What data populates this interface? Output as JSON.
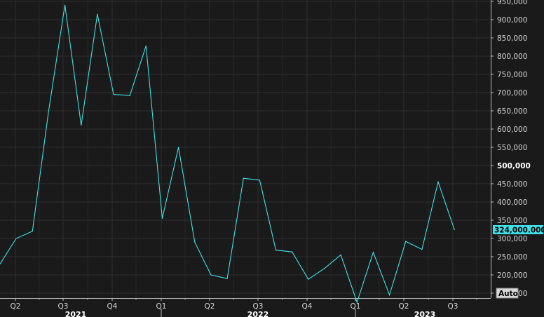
{
  "chart_data": {
    "type": "line",
    "series": [
      {
        "values": [
          230000,
          300000,
          320000,
          650000,
          940000,
          610000,
          915000,
          695000,
          692000,
          828000,
          355000,
          550000,
          290000,
          200000,
          190000,
          465000,
          460000,
          268000,
          263000,
          188000,
          218000,
          255000,
          125000,
          262000,
          145000,
          292000,
          270000,
          455000,
          324000
        ]
      }
    ],
    "ylim": [
      100000,
      950000
    ],
    "yticks": [
      "150,000",
      "200,000",
      "250,000",
      "300,000",
      "350,000",
      "400,000",
      "450,000",
      "500,000",
      "550,000",
      "600,000",
      "650,000",
      "700,000",
      "750,000",
      "800,000",
      "850,000",
      "900,000",
      "950,000"
    ],
    "ytick_values": [
      150000,
      200000,
      250000,
      300000,
      350000,
      400000,
      450000,
      500000,
      550000,
      600000,
      650000,
      700000,
      750000,
      800000,
      850000,
      900000,
      950000
    ],
    "xticks": [
      "Q2",
      "Q3",
      "Q4",
      "Q1",
      "Q2",
      "Q3",
      "Q4",
      "Q1",
      "Q2",
      "Q3"
    ],
    "years": [
      "2021",
      "2022",
      "2023"
    ],
    "last_value_label": "324,000.000",
    "scale_button": "Auto",
    "grid": true,
    "colors": {
      "line": "#40e0e8",
      "background": "#1a1a1a",
      "grid": "#2e2e2e",
      "last_value_bg": "#40e0e8"
    }
  }
}
